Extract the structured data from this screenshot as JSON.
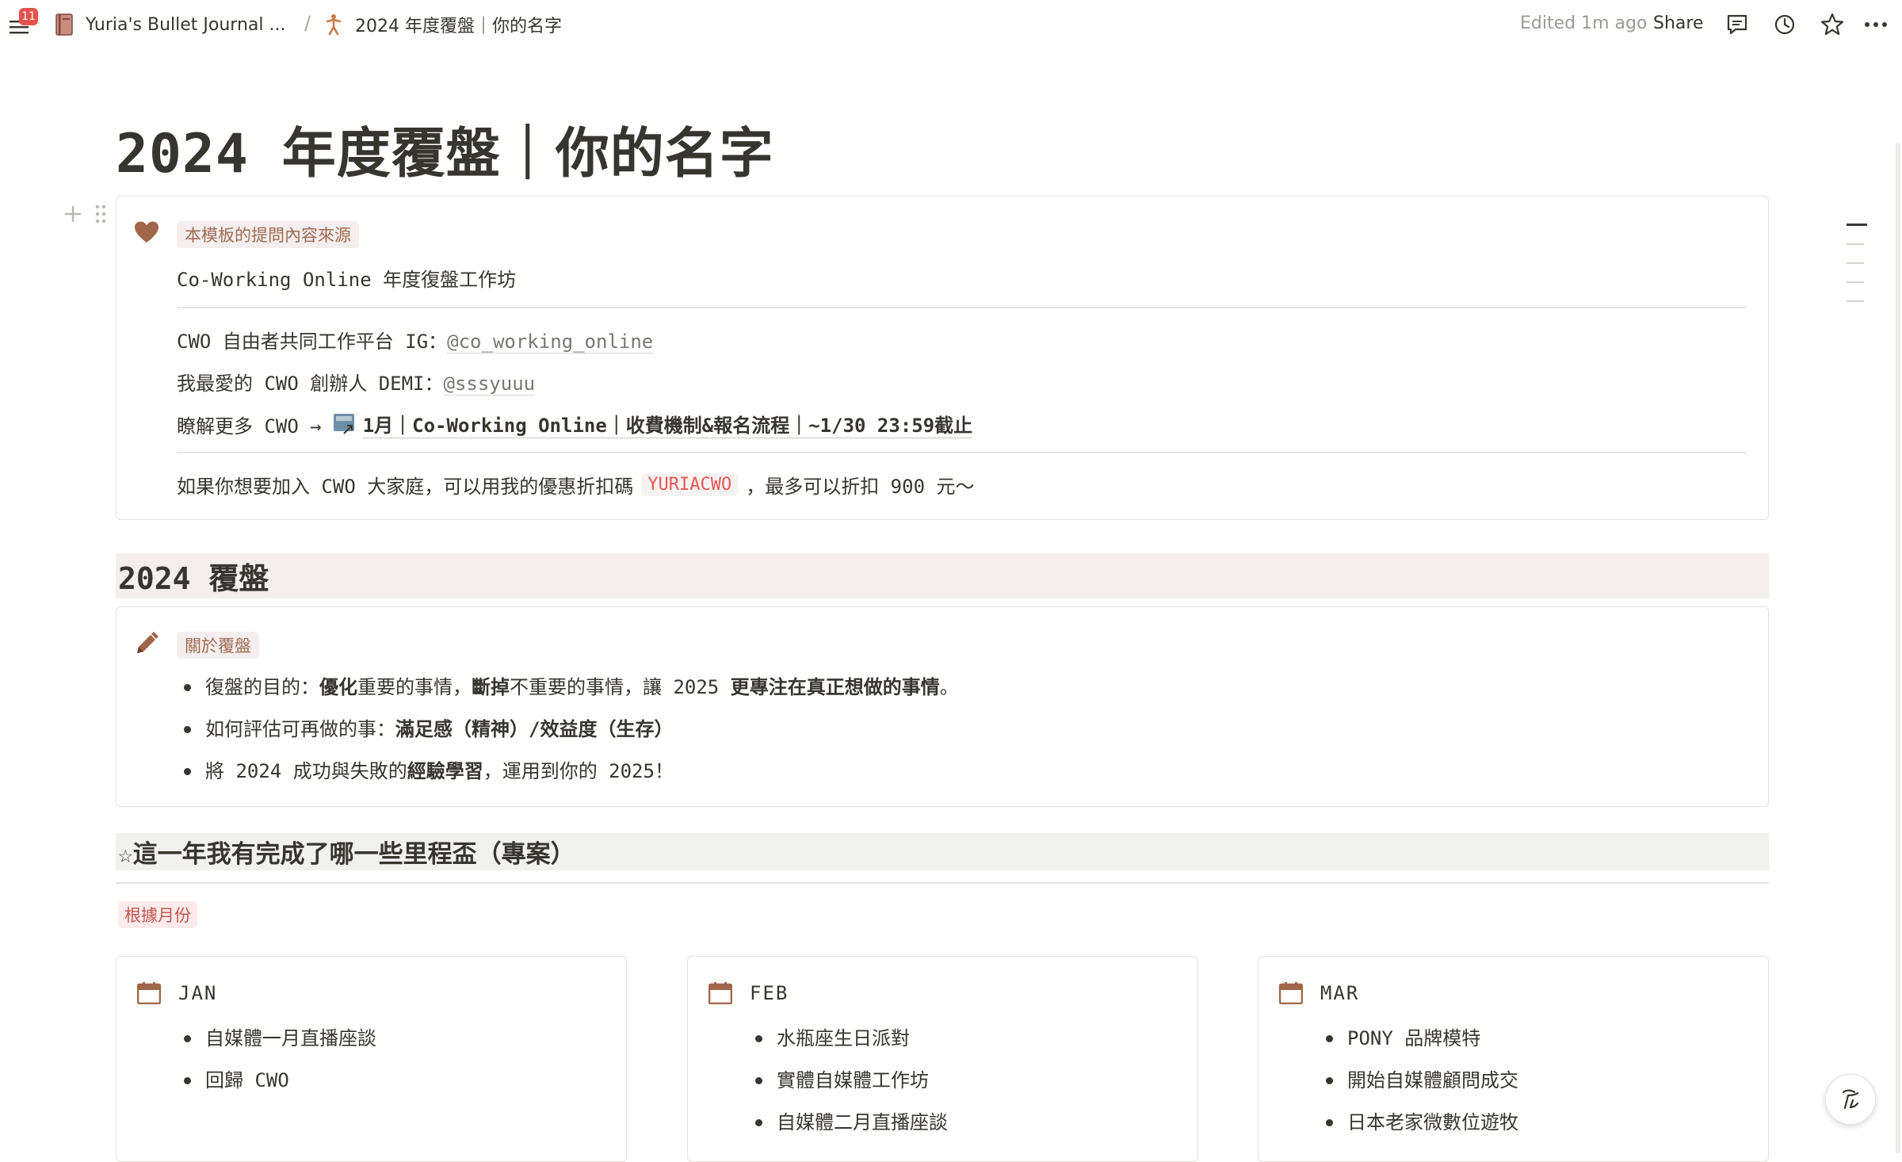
{
  "topbar": {
    "notification_count": "11",
    "workspace_name": "Yuria's Bullet Journal ...",
    "separator": "/",
    "page_name": "2024 年度覆盤｜你的名字",
    "edited_label": "Edited 1m ago",
    "share_label": "Share"
  },
  "page": {
    "title": "2024  年度覆盤｜你的名字"
  },
  "source_callout": {
    "tag": "本模板的提問內容來源",
    "line1": "Co-Working Online 年度復盤工作坊",
    "line2_prefix": "CWO 自由者共同工作平台 IG：",
    "line2_link": "@co_working_online",
    "line3_prefix": "我最愛的 CWO 創辦人 DEMI：",
    "line3_link": "@sssyuuu",
    "line4_prefix": "瞭解更多 CWO →",
    "line4_link": "1月｜Co-Working Online｜收費機制&報名流程｜~1/30 23:59截止",
    "line5_prefix": "如果你想要加入 CWO 大家庭，可以用我的優惠折扣碼",
    "line5_code": "YURIACWO",
    "line5_suffix": "，最多可以折扣 900 元～"
  },
  "review_heading": "2024  覆盤",
  "review_callout": {
    "tag": "關於覆盤",
    "b1": {
      "t1": "復盤的目的：",
      "t2": "優化",
      "t3": "重要的事情，",
      "t4": "斷掉",
      "t5": "不重要的事情，讓 2025 ",
      "t6": "更專注在真正想做的事情",
      "t7": "。"
    },
    "b2": {
      "t1": "如何評估可再做的事：",
      "t2": "滿足感（精神）/效益度（生存）"
    },
    "b3": {
      "t1": "將 2024 成功與失敗的",
      "t2": "經驗學習",
      "t3": "，運用到你的 2025！"
    }
  },
  "milestone_heading": "☆這一年我有完成了哪一些里程盃（專案）",
  "month_tag": "根據月份",
  "months": [
    {
      "name": "JAN",
      "items": [
        "自媒體一月直播座談",
        "回歸 CWO"
      ]
    },
    {
      "name": "FEB",
      "items": [
        "水瓶座生日派對",
        "實體自媒體工作坊",
        "自媒體二月直播座談"
      ]
    },
    {
      "name": "MAR",
      "items": [
        "PONY 品牌模特",
        "開始自媒體顧問成交",
        "日本老家微數位遊牧"
      ]
    }
  ],
  "colors": {
    "accent_brown": "#9f6b53",
    "code_red": "#eb5757",
    "heading_bg": "#f4efee"
  }
}
